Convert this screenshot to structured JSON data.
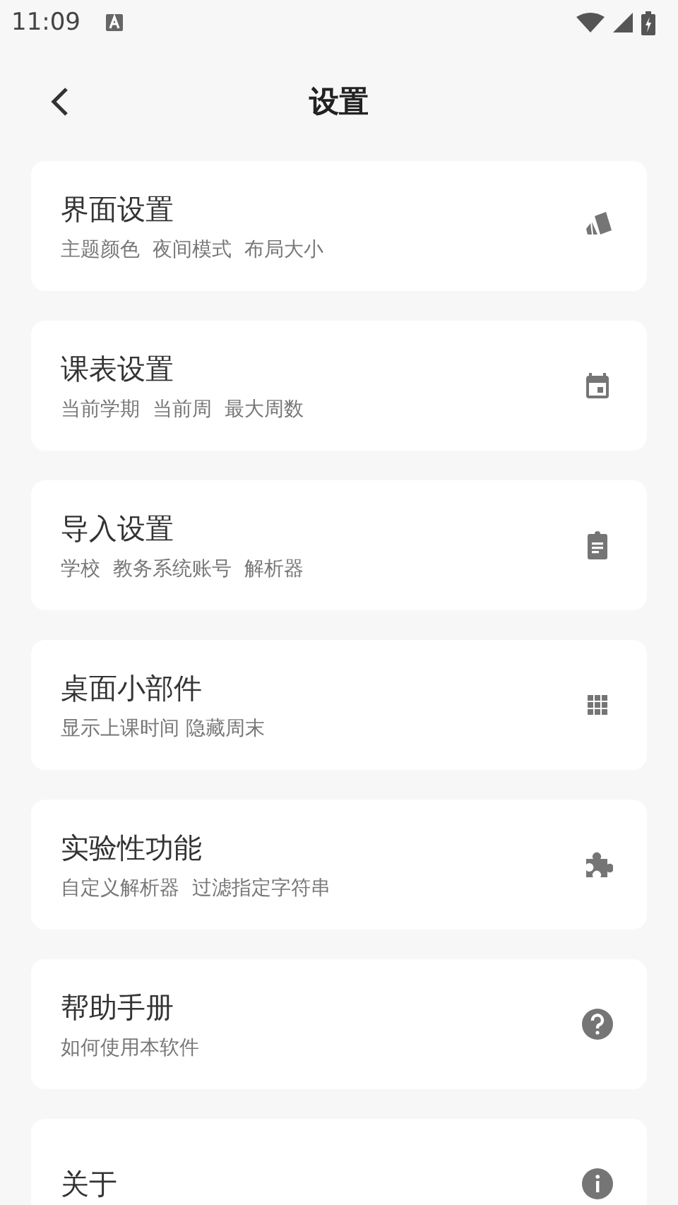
{
  "status_bar": {
    "time": "11:09"
  },
  "header": {
    "title": "设置"
  },
  "items": [
    {
      "title": "界面设置",
      "subtitle": "主题颜色  夜间模式  布局大小",
      "kind": "palette"
    },
    {
      "title": "课表设置",
      "subtitle": "当前学期  当前周  最大周数",
      "kind": "calendar"
    },
    {
      "title": "导入设置",
      "subtitle": "学校  教务系统账号  解析器",
      "kind": "clipboard"
    },
    {
      "title": "桌面小部件",
      "subtitle": "显示上课时间 隐藏周末",
      "kind": "grid"
    },
    {
      "title": "实验性功能",
      "subtitle": "自定义解析器  过滤指定字符串",
      "kind": "puzzle"
    },
    {
      "title": "帮助手册",
      "subtitle": "如何使用本软件",
      "kind": "help"
    },
    {
      "title": "关于",
      "kind": "info"
    }
  ]
}
